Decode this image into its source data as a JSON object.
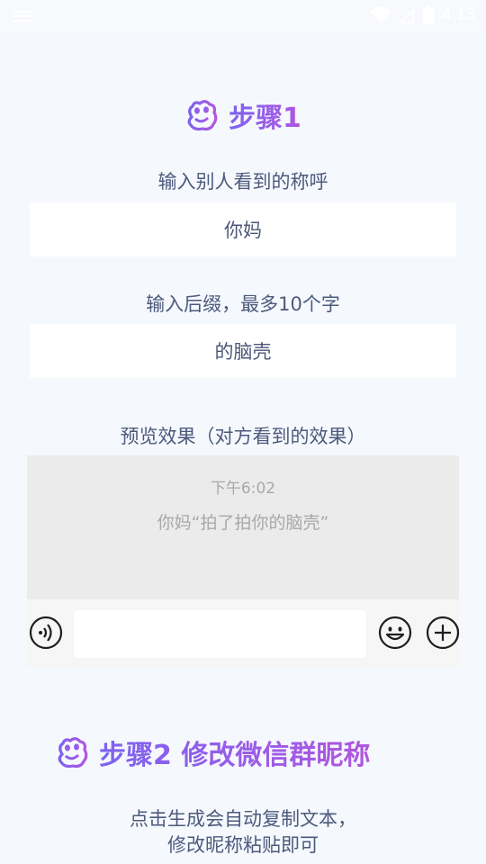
{
  "status_bar": {
    "time": "4:13",
    "icons": [
      "menu-icon",
      "wifi-icon",
      "signal-icon",
      "battery-icon"
    ]
  },
  "step1": {
    "title": "步骤1",
    "nickname_label": "输入别人看到的称呼",
    "nickname_value": "你妈",
    "suffix_label": "输入后缀，最多10个字",
    "suffix_value": "的脑壳",
    "preview_label": "预览效果（对方看到的效果）",
    "preview": {
      "time": "下午6:02",
      "message": "你妈“拍了拍你的脑壳”"
    }
  },
  "step2": {
    "title": "步骤2 修改微信群昵称",
    "hint_line1": "点击生成会自动复制文本，",
    "hint_line2": "修改昵称粘贴即可"
  },
  "colors": {
    "accent_start": "#7d63ef",
    "accent_end": "#b056df",
    "background": "#f5f8fd",
    "text": "#4c5a7c"
  }
}
